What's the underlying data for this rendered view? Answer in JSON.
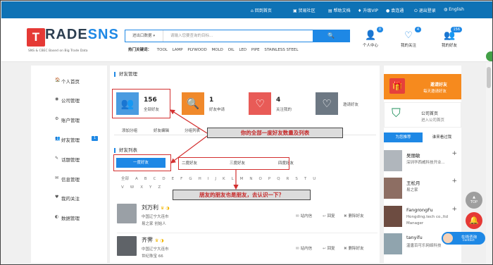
{
  "topbar": {
    "links": [
      {
        "icon": "home-icon",
        "glyph": "⌂",
        "label": "回到首页"
      },
      {
        "icon": "community-icon",
        "glyph": "▣",
        "label": "贸易社区"
      },
      {
        "icon": "doc-icon",
        "glyph": "▤",
        "label": "帮助文档"
      },
      {
        "icon": "vip-icon",
        "glyph": "♦",
        "label": "升级VIP"
      },
      {
        "icon": "user-avatar",
        "glyph": "●",
        "label": "袁连通"
      },
      {
        "icon": "logout-icon",
        "glyph": "⏻",
        "label": "退出登录"
      },
      {
        "icon": "globe-icon",
        "glyph": "◍",
        "label": "English"
      }
    ]
  },
  "header": {
    "logo_letter": "T",
    "logo_text_a": "RADE",
    "logo_text_b": "SNS",
    "logo_sub": "SNS & CBEC Based on Big Trade Data",
    "search_category": "进出口数据",
    "search_placeholder": "请输入您要查询的目标...",
    "search_button": "🔍",
    "hot_label": "热门关键词：",
    "hot_keywords": [
      "TOOL",
      "LAMP",
      "PLYWOOD",
      "MOLD",
      "OIL",
      "LED",
      "PIPE",
      "STAINLESS STEEL"
    ],
    "icons": [
      {
        "glyph": "👤",
        "badge": "0",
        "label": "个人中心"
      },
      {
        "glyph": "♡",
        "badge": "4",
        "label": "我的关注"
      },
      {
        "glyph": "👥",
        "badge": "156",
        "label": "我的好友"
      }
    ]
  },
  "sidebar": {
    "items": [
      {
        "icon": "🏠",
        "label": "个人首页"
      },
      {
        "icon": "◉",
        "label": "公司管理"
      },
      {
        "icon": "⚙",
        "label": "账户管理"
      },
      {
        "icon": "👥",
        "label": "好友管理",
        "badge": "1"
      },
      {
        "icon": "✎",
        "label": "话题管理"
      },
      {
        "icon": "✉",
        "label": "信息管理"
      },
      {
        "icon": "♥",
        "label": "我的关注"
      },
      {
        "icon": "◐",
        "label": "数据管理"
      }
    ]
  },
  "main": {
    "friend_mgmt_title": "好友管理",
    "stats": [
      {
        "num": "156",
        "label": "全部好友",
        "color": "#4a9be0",
        "glyph": "👥"
      },
      {
        "num": "1",
        "label": "好友申请",
        "color": "#f0892b",
        "glyph": "🔍"
      },
      {
        "num": "4",
        "label": "关注我的",
        "color": "#e85b57",
        "glyph": "♡"
      },
      {
        "num": "",
        "label": "邀请好友",
        "color": "#6d7883",
        "glyph": "♡"
      }
    ],
    "subtabs": [
      "添加分组",
      "好友编辑",
      "分组列表"
    ],
    "friend_list_title": "好友列表",
    "degree_tabs": [
      "一度好友",
      "二度好友",
      "三度好友",
      "四度好友"
    ],
    "alphabet": [
      "全部",
      "A",
      "B",
      "C",
      "D",
      "E",
      "F",
      "G",
      "H",
      "I",
      "J",
      "K",
      "L",
      "M",
      "N",
      "O",
      "P",
      "Q",
      "R",
      "S",
      "T",
      "U",
      "V",
      "W",
      "X",
      "Y",
      "Z"
    ],
    "friends": [
      {
        "name": "刘万利",
        "badges": "♛ ◑",
        "company": "中国辽宁大连市",
        "role": "易之家   创始人"
      },
      {
        "name": "齐霁",
        "badges": "♛ ◑",
        "company": "中国辽宁大连市",
        "role": "世纪珠宝   66"
      }
    ],
    "actions": [
      "站内信",
      "回复",
      "删除好友"
    ]
  },
  "right": {
    "invite_title": "邀请好友",
    "invite_sub": "每天邀请好友",
    "home_title": "公司首页",
    "home_sub": "进入公司首页",
    "tabs": [
      "为您推荐",
      "谁来看过我"
    ],
    "people": [
      {
        "name": "吴丽敏",
        "company": "深圳华西威科技开业..."
      },
      {
        "name": "王松月",
        "company": "易之家"
      },
      {
        "name": "FangrongFu",
        "company": "Hongding.tech co.,ltd",
        "extra": "Manager"
      },
      {
        "name": "tanyifu",
        "company": "温唐百可乐网络科技"
      }
    ]
  },
  "annotations": {
    "callout1": "你的全部一度好友数量及列表",
    "callout2": "朋友的朋友也是朋友，去认识一下？"
  },
  "float": {
    "top": "TOP",
    "bell": "🔔",
    "chat_line1": "在线咨询",
    "chat_line2": "contact"
  }
}
